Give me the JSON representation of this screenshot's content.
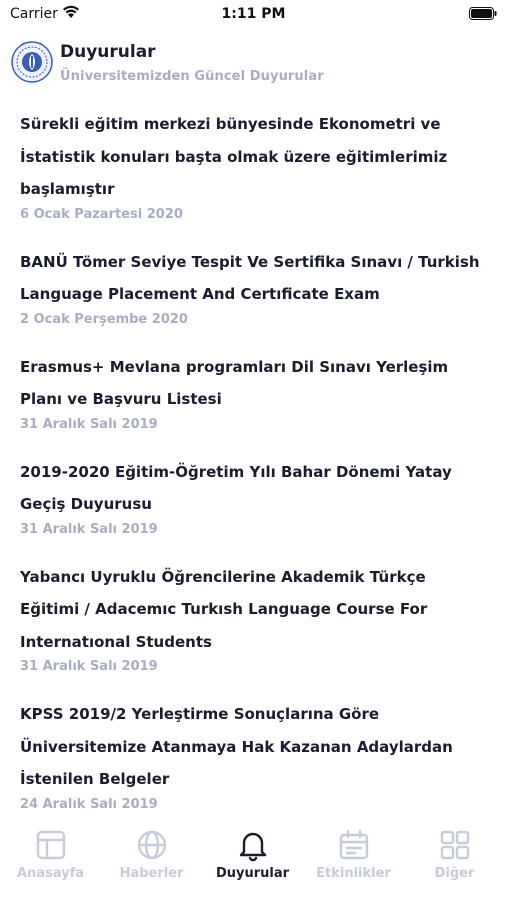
{
  "status_bar": {
    "carrier": "Carrier",
    "time": "1:11 PM"
  },
  "header": {
    "title": "Duyurular",
    "subtitle": "Üniversitemizden Güncel Duyurular"
  },
  "announcements": [
    {
      "title": "Sürekli eğitim merkezi bünyesinde Ekonometri ve İstatistik konuları başta olmak üzere eğitimlerimiz başlamıştır",
      "date": "6 Ocak Pazartesi  2020"
    },
    {
      "title": "BANÜ Tömer Seviye Tespit Ve Sertifika Sınavı / Turkish Language Placement And Certıficate Exam",
      "date": "2 Ocak Perşembe  2020"
    },
    {
      "title": "Erasmus+ Mevlana programları Dil Sınavı Yerleşim Planı ve Başvuru Listesi",
      "date": "31 Aralık Salı  2019"
    },
    {
      "title": "2019-2020 Eğitim-Öğretim Yılı Bahar Dönemi Yatay Geçiş Duyurusu",
      "date": "31 Aralık Salı  2019"
    },
    {
      "title": "Yabancı Uyruklu Öğrencilerine Akademik Türkçe Eğitimi / Adacemıc Turkısh Language Course For Internatıonal Students",
      "date": "31 Aralık Salı  2019"
    },
    {
      "title": "KPSS 2019/2 Yerleştirme Sonuçlarına Göre Üniversitemize Atanmaya Hak Kazanan Adaylardan İstenilen Belgeler",
      "date": "24 Aralık Salı  2019"
    }
  ],
  "tabs": [
    {
      "label": "Anasayfa",
      "icon": "layout-icon",
      "active": false
    },
    {
      "label": "Haberler",
      "icon": "globe-icon",
      "active": false
    },
    {
      "label": "Duyurular",
      "icon": "bell-icon",
      "active": true
    },
    {
      "label": "Etkinlikler",
      "icon": "calendar-icon",
      "active": false
    },
    {
      "label": "Diğer",
      "icon": "grid-icon",
      "active": false
    }
  ],
  "colors": {
    "text": "#1b1d2e",
    "muted": "#a8adbf",
    "inactive_tab": "#c8ccd8",
    "logo_blue": "#3a5db5"
  }
}
